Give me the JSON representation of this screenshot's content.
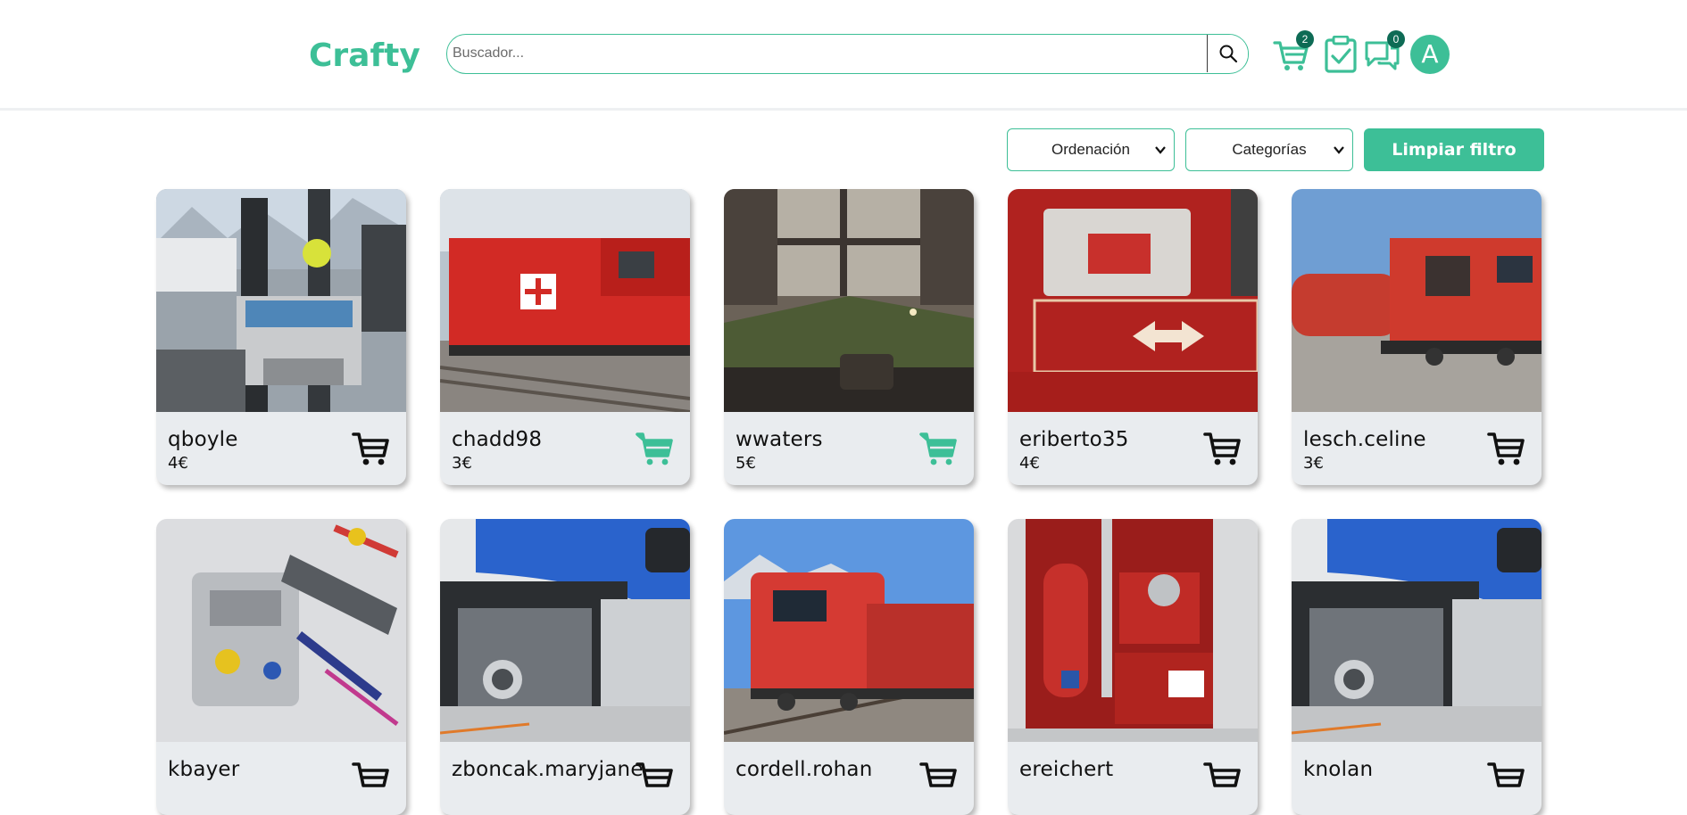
{
  "brand": {
    "name": "Crafty",
    "color": "#3dbf97"
  },
  "search": {
    "placeholder": "Buscador...",
    "value": ""
  },
  "header": {
    "cart_count": "2",
    "orders_icon": "clipboard-check-icon",
    "messages_count": "0",
    "avatar_letter": "A"
  },
  "filters": {
    "sort_label": "Ordenación",
    "category_label": "Categorías",
    "clear_label": "Limpiar filtro"
  },
  "colors": {
    "accent": "#3dbf97",
    "badge": "#0e6b55",
    "card_bg": "#e9ecef"
  },
  "products": [
    {
      "user": "qboyle",
      "price": "4€",
      "in_cart": false,
      "image": "control-panel"
    },
    {
      "user": "chadd98",
      "price": "3€",
      "in_cart": true,
      "image": "red-locomotive"
    },
    {
      "user": "wwaters",
      "price": "5€",
      "in_cart": true,
      "image": "model-layout"
    },
    {
      "user": "eriberto35",
      "price": "4€",
      "in_cart": false,
      "image": "sbb-plate"
    },
    {
      "user": "lesch.celine",
      "price": "3€",
      "in_cart": false,
      "image": "rescue-train"
    },
    {
      "user": "kbayer",
      "price": "",
      "in_cart": false,
      "image": "lego-engine"
    },
    {
      "user": "zboncak.maryjane",
      "price": "",
      "in_cart": false,
      "image": "train-coupler"
    },
    {
      "user": "cordell.rohan",
      "price": "",
      "in_cart": false,
      "image": "red-diesel"
    },
    {
      "user": "ereichert",
      "price": "",
      "in_cart": false,
      "image": "hydraulic-unit"
    },
    {
      "user": "knolan",
      "price": "",
      "in_cart": false,
      "image": "train-coupler"
    }
  ]
}
